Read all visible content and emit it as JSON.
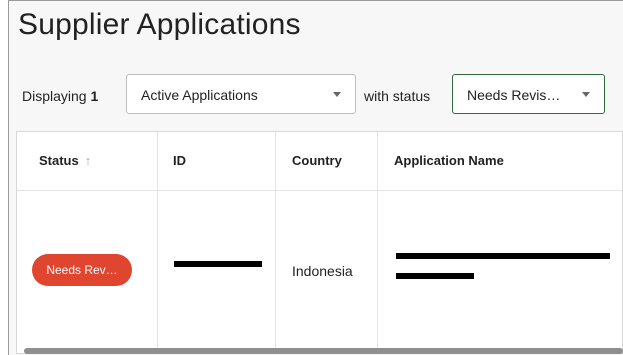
{
  "page": {
    "title": "Supplier Applications"
  },
  "filters": {
    "displaying_label": "Displaying",
    "displaying_count": "1",
    "application_type": "Active Applications",
    "with_status_label": "with status",
    "status_value": "Needs Revis…"
  },
  "table": {
    "columns": [
      {
        "label": "Status",
        "sort": "ascending"
      },
      {
        "label": "ID"
      },
      {
        "label": "Country"
      },
      {
        "label": "Application Name"
      }
    ],
    "rows": [
      {
        "status": "Needs Rev…",
        "id": "[redacted]",
        "country": "Indonesia",
        "application_name": "[redacted]"
      }
    ]
  },
  "colors": {
    "status_badge": "#e0452f",
    "status_select_border": "#2e6b3a"
  }
}
